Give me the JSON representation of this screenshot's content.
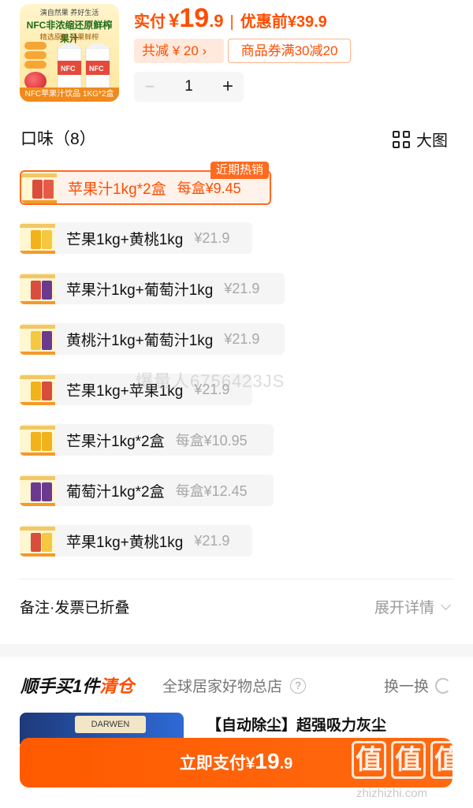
{
  "product": {
    "thumb_brand": "演自然果 养好生活",
    "thumb_headline": "NFC非浓缩还原鲜榨果汁",
    "thumb_sub": "精选原料 原果鲜榨",
    "thumb_footer": "NFC苹果汁饮品 1KG*2盒"
  },
  "price": {
    "label": "实付",
    "currency": "¥",
    "integer": "19",
    "decimal": ".9",
    "separator": "|",
    "original_label": "优惠前",
    "original_price": "¥39.9"
  },
  "discount": {
    "total_label": "共减 ¥ 20 ›",
    "coupon_label": "商品券满30减20"
  },
  "stepper": {
    "minus": "−",
    "quantity": "1",
    "plus": "+"
  },
  "flavor": {
    "title": "口味（8）",
    "view_label": "大图",
    "hot_tag": "近期热销",
    "options": [
      {
        "name": "苹果汁1kg*2盒",
        "price": "每盒¥9.45",
        "selected": true,
        "c1": "#d94d3c",
        "c2": "#e65b48"
      },
      {
        "name": "芒果1kg+黄桃1kg",
        "price": "¥21.9",
        "selected": false,
        "c1": "#f2b21c",
        "c2": "#f5c842"
      },
      {
        "name": "苹果汁1kg+葡萄汁1kg",
        "price": "¥21.9",
        "selected": false,
        "c1": "#d94d3c",
        "c2": "#6b3a8e"
      },
      {
        "name": "黄桃汁1kg+葡萄汁1kg",
        "price": "¥21.9",
        "selected": false,
        "c1": "#f5c842",
        "c2": "#6b3a8e"
      },
      {
        "name": "芒果1kg+苹果1kg",
        "price": "¥21.9",
        "selected": false,
        "c1": "#f2b21c",
        "c2": "#d94d3c"
      },
      {
        "name": "芒果汁1kg*2盒",
        "price": "每盒¥10.95",
        "selected": false,
        "c1": "#f2b21c",
        "c2": "#f2b21c"
      },
      {
        "name": "葡萄汁1kg*2盒",
        "price": "每盒¥12.45",
        "selected": false,
        "c1": "#6b3a8e",
        "c2": "#6b3a8e"
      },
      {
        "name": "苹果1kg+黄桃1kg",
        "price": "¥21.9",
        "selected": false,
        "c1": "#d94d3c",
        "c2": "#f5c842"
      }
    ]
  },
  "watermark": "爆量人6756423JS",
  "remark": {
    "label": "备注·发票已折叠",
    "expand_label": "展开详情"
  },
  "recommend": {
    "title_prefix": "顺手买1件",
    "title_highlight": "清仓",
    "store": "全球居家好物总店",
    "help_glyph": "?",
    "swap_label": "换一换",
    "item_brand": "DARWEN",
    "item_title": "【自动除尘】超强吸力灰尘"
  },
  "pay": {
    "label": "立即支付",
    "currency": "¥",
    "integer": "19",
    "decimal": ".9"
  },
  "site": {
    "logo_chars": [
      "值",
      "值",
      "值"
    ],
    "url": "zhizhizhi.com"
  },
  "colors": {
    "accent": "#ff4d00",
    "hot_tag": "#ff6a1f",
    "muted": "#a8a8a8"
  }
}
